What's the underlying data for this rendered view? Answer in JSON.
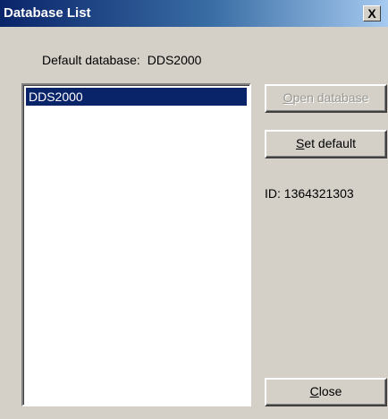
{
  "window": {
    "title": "Database List",
    "close_glyph": "X"
  },
  "default_database": {
    "label": "Default database:",
    "value": "DDS2000"
  },
  "database_list": {
    "items": [
      {
        "label": "DDS2000",
        "selected": true
      }
    ]
  },
  "buttons": {
    "open": {
      "mnemonic": "O",
      "rest": "pen database",
      "enabled": false
    },
    "set_default": {
      "mnemonic": "S",
      "rest": "et default",
      "enabled": true
    },
    "close": {
      "mnemonic": "C",
      "rest": "lose",
      "enabled": true
    }
  },
  "id_text": "ID: 1364321303",
  "colors": {
    "face": "#d4d0c8",
    "title_start": "#0a246a",
    "title_end": "#a6caf0",
    "selection": "#0a246a",
    "disabled_text": "#9a9892"
  }
}
